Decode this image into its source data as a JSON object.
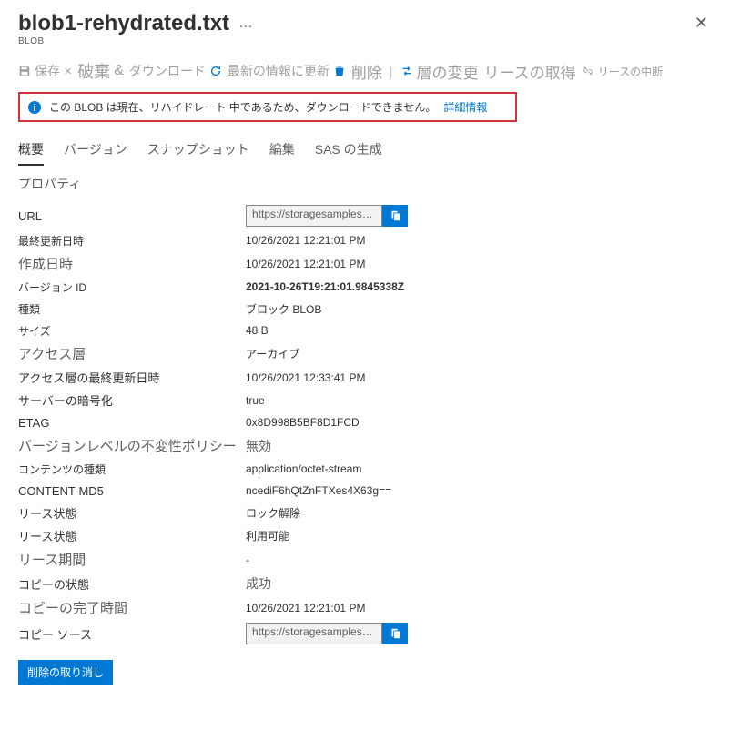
{
  "header": {
    "title": "blob1-rehydrated.txt",
    "subtitle": "BLOB",
    "more": "…",
    "close": "✕"
  },
  "toolbar": {
    "save": "保存",
    "discard": "破棄",
    "download": "ダウンロード",
    "refresh": "最新の情報に更新",
    "delete": "削除",
    "change_tier": "層の変更",
    "acquire_lease": "リースの取得",
    "break_lease": "リースの中断"
  },
  "notice": {
    "text": "この BLOB は現在、リハイドレート 中であるため、ダウンロードできません。",
    "link": "詳細情報"
  },
  "tabs": {
    "overview": "概要",
    "versions": "バージョン",
    "snapshots": "スナップショット",
    "edit": "編集",
    "sas": "SAS の生成"
  },
  "section": {
    "properties": "プロパティ"
  },
  "props": {
    "url_label": "URL",
    "url_value": "https://storagesamples…",
    "last_modified_label": "最終更新日時",
    "last_modified_value": "10/26/2021 12:21:01 PM",
    "creation_time_label": "作成日時",
    "creation_time_value": "10/26/2021 12:21:01 PM",
    "version_id_label": "バージョン ID",
    "version_id_value": "2021-10-26T19:21:01.9845338Z",
    "type_label": "種類",
    "type_value": "ブロック BLOB",
    "size_label": "サイズ",
    "size_value": "48 B",
    "access_tier_label": "アクセス層",
    "access_tier_value": "アーカイブ",
    "access_tier_mod_label": "アクセス層の最終更新日時",
    "access_tier_mod_value": "10/26/2021 12:33:41 PM",
    "server_encrypt_label": "サーバーの暗号化",
    "server_encrypt_value": "true",
    "etag_label": "ETAG",
    "etag_value": "0x8D998B5BF8D1FCD",
    "immutability_label": "バージョンレベルの不変性ポリシー",
    "immutability_value": "無効",
    "content_type_label": "コンテンツの種類",
    "content_type_value": "application/octet-stream",
    "content_md5_label": "CONTENT-MD5",
    "content_md5_value": "ncediF6hQtZnFTXes4X63g==",
    "lease_status_label": "リース状態",
    "lease_status_value": "ロック解除",
    "lease_state_label": "リース状態",
    "lease_state_value": "利用可能",
    "lease_duration_label": "リース期間",
    "lease_duration_value": "-",
    "copy_status_label": "コピーの状態",
    "copy_status_value": "成功",
    "copy_completion_label": "コピーの完了時間",
    "copy_completion_value": "10/26/2021 12:21:01 PM",
    "copy_source_label": "コピー ソース",
    "copy_source_value": "https://storagesamples…"
  },
  "buttons": {
    "undelete": "削除の取り消し"
  }
}
